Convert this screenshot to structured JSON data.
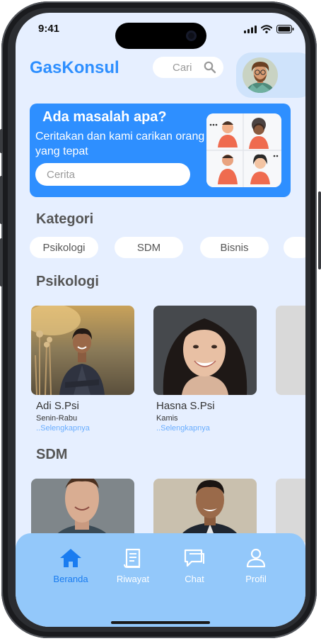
{
  "status": {
    "time": "9:41"
  },
  "header": {
    "brand": "GasKonsul",
    "search_placeholder": "Cari"
  },
  "banner": {
    "title": "Ada masalah apa?",
    "subtitle": "Ceritakan dan kami carikan orang yang tepat",
    "input_placeholder": "Cerita"
  },
  "categories": {
    "title": "Kategori",
    "chips": [
      "Psikologi",
      "SDM",
      "Bisnis"
    ]
  },
  "psikologi": {
    "title": "Psikologi",
    "consultants": [
      {
        "name": "Adi S.Psi",
        "schedule": "Senin-Rabu",
        "more": "..Selengkapnya"
      },
      {
        "name": "Hasna S.Psi",
        "schedule": "Kamis",
        "more": "..Selengkapnya"
      }
    ]
  },
  "sdm": {
    "title": "SDM"
  },
  "nav": {
    "items": [
      {
        "label": "Beranda",
        "icon": "home-icon",
        "active": true
      },
      {
        "label": "Riwayat",
        "icon": "history-icon",
        "active": false
      },
      {
        "label": "Chat",
        "icon": "chat-icon",
        "active": false
      },
      {
        "label": "Profil",
        "icon": "user-icon",
        "active": false
      }
    ]
  },
  "colors": {
    "accent": "#2e8fff",
    "background": "#e6efff",
    "navbar": "#93c8fa",
    "link": "#6aaeff",
    "active_nav": "#1a7cf0"
  }
}
